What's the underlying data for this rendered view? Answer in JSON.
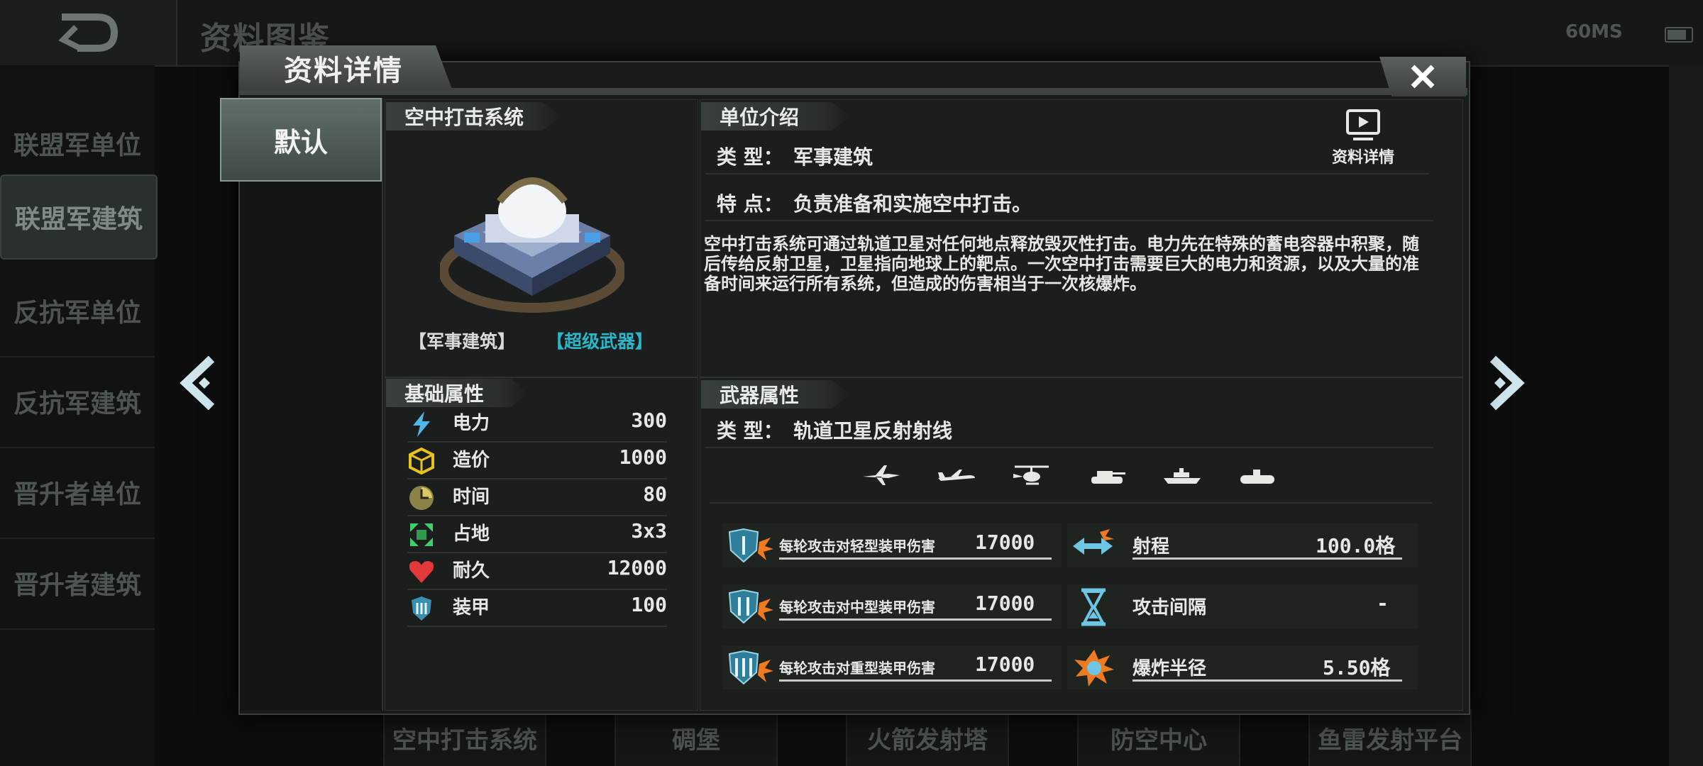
{
  "header": {
    "title": "资料图鉴",
    "ping": "60MS"
  },
  "sidebar": {
    "items": [
      {
        "label": "联盟军单位"
      },
      {
        "label": "联盟军建筑"
      },
      {
        "label": "反抗军单位"
      },
      {
        "label": "反抗军建筑"
      },
      {
        "label": "晋升者单位"
      },
      {
        "label": "晋升者建筑"
      }
    ]
  },
  "bottom_tabs": [
    "空中打击系统",
    "碉堡",
    "火箭发射塔",
    "防空中心",
    "鱼雷发射平台"
  ],
  "modal": {
    "title": "资料详情",
    "variant": "默认",
    "unit_header": "空中打击系统",
    "tags": [
      "【军事建筑】",
      "【超级武器】"
    ],
    "tag_colors": [
      "#e6e9e3",
      "#2bb7c9"
    ],
    "base_header": "基础属性",
    "stats": [
      {
        "icon": "power-icon",
        "label": "电力",
        "value": "300"
      },
      {
        "icon": "cost-icon",
        "label": "造价",
        "value": "1000"
      },
      {
        "icon": "time-icon",
        "label": "时间",
        "value": "80"
      },
      {
        "icon": "footprint-icon",
        "label": "占地",
        "value": "3x3"
      },
      {
        "icon": "health-icon",
        "label": "耐久",
        "value": "12000"
      },
      {
        "icon": "armor-icon",
        "label": "装甲",
        "value": "100"
      }
    ],
    "intro_header": "单位介绍",
    "type_key": "类    型：",
    "type_value": "军事建筑",
    "feature_key": "特    点：",
    "feature_value": "负责准备和实施空中打击。",
    "video_label": "资料详情",
    "description": "空中打击系统可通过轨道卫星对任何地点释放毁灭性打击。电力先在特殊的蓄电容器中积聚，随后传给反射卫星，卫星指向地球上的靶点。一次空中打击需要巨大的电力和资源，以及大量的准备时间来运行所有系统，但造成的伤害相当于一次核爆炸。",
    "weapon_header": "武器属性",
    "weapon_type_key": "类    型：",
    "weapon_type_value": "轨道卫星反射射线",
    "targets": [
      "fighter-jet-icon",
      "bomber-icon",
      "helicopter-icon",
      "tank-icon",
      "ship-icon",
      "submarine-icon"
    ],
    "damage": [
      {
        "label": "每轮攻击对轻型装甲伤害",
        "value": "17000"
      },
      {
        "label": "每轮攻击对中型装甲伤害",
        "value": "17000"
      },
      {
        "label": "每轮攻击对重型装甲伤害",
        "value": "17000"
      }
    ],
    "weapon_stats": [
      {
        "label": "射程",
        "value": "100.0格"
      },
      {
        "label": "攻击间隔",
        "value": "-"
      },
      {
        "label": "爆炸半径",
        "value": "5.50格"
      }
    ]
  }
}
